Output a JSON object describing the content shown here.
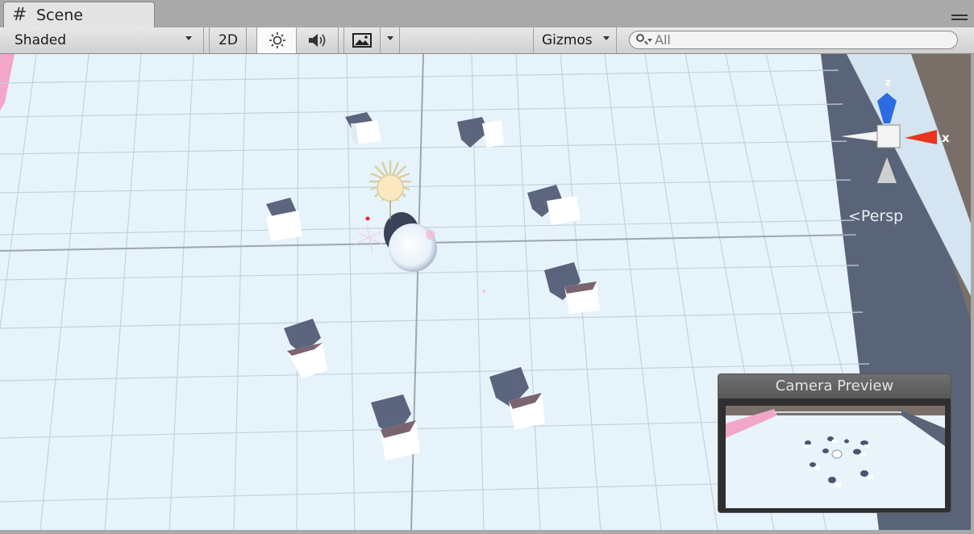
{
  "window": {
    "tab_label": "Scene",
    "tab_icon": "hash-icon"
  },
  "toolbar": {
    "draw_mode": "Shaded",
    "mode_2d": "2D",
    "lighting_icon": "sun-icon",
    "audio_icon": "speaker-icon",
    "effects_icon": "image-icon",
    "gizmos_label": "Gizmos",
    "search_placeholder": "All"
  },
  "gizmo": {
    "x_label": "x",
    "z_label": "z",
    "projection_label": "Persp",
    "x_color": "#e8361c",
    "z_color": "#2c6be0"
  },
  "camera_preview": {
    "title": "Camera Preview"
  },
  "colors": {
    "floor": "#e6f3fa",
    "grid_line": "#c4d2de",
    "wall": "#5a6478",
    "accent_pink": "#f2a6c8"
  }
}
